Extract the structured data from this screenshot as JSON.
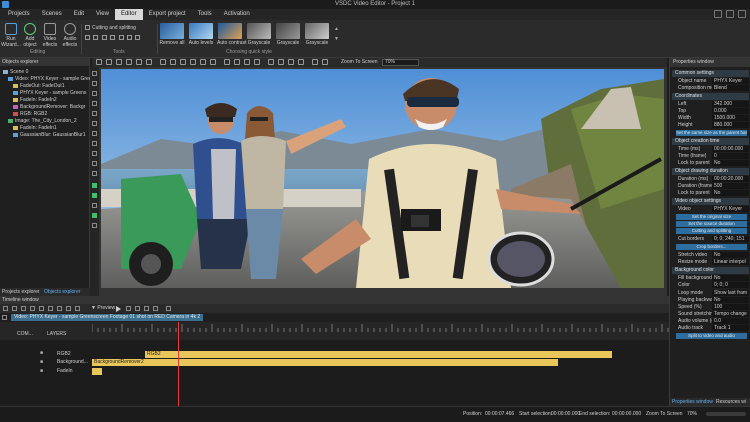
{
  "window": {
    "title": "VSDC Video Editor - Project 1"
  },
  "menu": {
    "items": [
      {
        "label": "Projects",
        "active": false
      },
      {
        "label": "Scenes",
        "active": false
      },
      {
        "label": "Edit",
        "active": false
      },
      {
        "label": "View",
        "active": false
      },
      {
        "label": "Editor",
        "active": true
      },
      {
        "label": "Export project",
        "active": false
      },
      {
        "label": "Tools",
        "active": false
      },
      {
        "label": "Activation",
        "active": false
      }
    ]
  },
  "ribbon": {
    "run_label": "Run\nWizard...",
    "add_object_label": "Add\nobject",
    "video_effects_label": "Video\neffects",
    "audio_effects_label": "Audio\neffects",
    "editing_group": "Editing",
    "cutting_label": "Cutting and splitting",
    "tools_group": "Tools",
    "quick_style_group": "Choosing quick style",
    "styles": [
      {
        "label": "Remove all",
        "color": "#3b6fb0"
      },
      {
        "label": "Auto levels",
        "color": "#4a86c8"
      },
      {
        "label": "Auto contrast",
        "color": "#5a8fd0"
      },
      {
        "label": "Grayscale",
        "color": "#8a8a8a"
      },
      {
        "label": "Grayscale",
        "color": "#7a7a7a"
      },
      {
        "label": "Grayscale",
        "color": "#9a9a9a"
      }
    ]
  },
  "editor_toolbar": {
    "zoom_label": "Zoom To Screen",
    "zoom_value": "70%"
  },
  "objects_explorer": {
    "title": "Objects explorer",
    "tree": [
      {
        "label": "Scene 0",
        "indent": 0,
        "color": "#8ab4d8"
      },
      {
        "label": "Video: PHYX Keyer - sample Greer",
        "indent": 1,
        "color": "#5aa0d8"
      },
      {
        "label": "FadeOut: FadeOut1",
        "indent": 2,
        "color": "#d8c050"
      },
      {
        "label": "PHYX Keyer - sample Greens",
        "indent": 2,
        "color": "#5aa0d8"
      },
      {
        "label": "FadeIn: FadeIn2",
        "indent": 2,
        "color": "#d8c050"
      },
      {
        "label": "BackgroundRemover: Backgr",
        "indent": 2,
        "color": "#c060c0"
      },
      {
        "label": "RGB: RGB2",
        "indent": 2,
        "color": "#d05050"
      },
      {
        "label": "Image: The_City_London_2",
        "indent": 1,
        "color": "#50b070"
      },
      {
        "label": "FadeIn: FadeIn1",
        "indent": 2,
        "color": "#d8c050"
      },
      {
        "label": "GaussianBlur: GaussianBlur1",
        "indent": 2,
        "color": "#60a0d0"
      }
    ],
    "tabs": [
      "Projects explorer",
      "Objects explorer"
    ]
  },
  "properties": {
    "title": "Properties window",
    "sections": [
      {
        "label": "Common settings"
      },
      {
        "label": "Coordinates"
      },
      {
        "label": "Object creation time"
      },
      {
        "label": "Object drawing duration"
      },
      {
        "label": "Video object settings"
      },
      {
        "label": "Background color"
      }
    ],
    "rows": {
      "object_name": {
        "k": "Object name",
        "v": "PHYX Keyer"
      },
      "composition_mode": {
        "k": "Composition mo",
        "v": "Blend"
      },
      "left": {
        "k": "Left",
        "v": "342.000"
      },
      "top": {
        "k": "Top",
        "v": "0.000"
      },
      "width": {
        "k": "Width",
        "v": "1500.000"
      },
      "height": {
        "k": "Height",
        "v": "880.000"
      },
      "time_ms": {
        "k": "Time (ms)",
        "v": "00:00:00.000"
      },
      "time_frame": {
        "k": "Time (frame)",
        "v": "0"
      },
      "lock_parent1": {
        "k": "Lock to parent",
        "v": "No"
      },
      "duration_ms": {
        "k": "Duration (ms)",
        "v": "00:00:20.000"
      },
      "duration_frames": {
        "k": "Duration (frame)",
        "v": "500"
      },
      "lock_parent2": {
        "k": "Lock to parent",
        "v": "No"
      },
      "video": {
        "k": "Video",
        "v": "PHYX Keyer"
      },
      "cut_borders": {
        "k": "Cut borders",
        "v": "0; 0; 240; 151"
      },
      "stretch_video": {
        "k": "Stretch video",
        "v": "No"
      },
      "resize_mode": {
        "k": "Resize mode",
        "v": "Linear interpol"
      },
      "fill_background": {
        "k": "Fill background",
        "v": "No"
      },
      "color": {
        "k": "Color",
        "v": "0; 0; 0"
      },
      "loop_mode": {
        "k": "Loop mode",
        "v": "Show last fram"
      },
      "playing_backward": {
        "k": "Playing backward",
        "v": "No"
      },
      "speed": {
        "k": "Speed (%)",
        "v": "100"
      },
      "sound_stretching": {
        "k": "Sound stretching",
        "v": "Tempo change"
      },
      "audio_volume": {
        "k": "Audio volume (d",
        "v": "0.0"
      },
      "audio_track": {
        "k": "Audio track",
        "v": "Track 1"
      }
    },
    "buttons": {
      "same_size": "Set the same size as the parent has",
      "original_size": "Set the original size",
      "source_duration": "Set the source duration",
      "cutting": "Cutting and splitting",
      "crop": "Crop borders...",
      "split": "Split to video and audio"
    },
    "tabs": [
      "Properties window",
      "Resources wi"
    ]
  },
  "timeline": {
    "title": "Timeline window",
    "preview_label": "Preview",
    "clip_tab": "Video: PHYX Keyer - sample Greenscreen Footage 01 shot on RED Camera in 4k 2",
    "layer_label": "LAYERS",
    "com_label": "COM...",
    "tracks": [
      {
        "name": "RGB2",
        "clip": "RGB2"
      },
      {
        "name": "Background...",
        "clip": "BackgroundRemover2"
      },
      {
        "name": "FadeIn",
        "clip": ""
      }
    ]
  },
  "status": {
    "position_label": "Position:",
    "position_value": "00:00:07.466",
    "start_label": "Start selection:",
    "start_value": "00:00:00.000",
    "end_label": "End selection:",
    "end_value": "00:00:00.000",
    "zoom_label": "Zoom To Screen",
    "zoom_value": "70%"
  }
}
